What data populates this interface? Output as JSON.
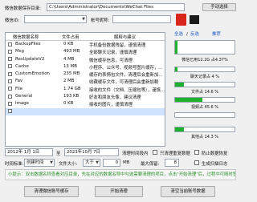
{
  "path_row": {
    "label": "微信数据保存目录:",
    "value": "C:\\Users\\Administrator\\Documents\\WeChat Files",
    "button": "手动选择"
  },
  "id_row": {
    "label": "微信ID:",
    "account_label": "帐号昵称:"
  },
  "table": {
    "headers": [
      "微信数据名称",
      "文件占用",
      "解释与建议"
    ],
    "rows": [
      {
        "name": "BackupFiles",
        "size": "0 KB",
        "desc": "手机备份数据残留，谨慎清理"
      },
      {
        "name": "Msg",
        "size": "493 MB",
        "desc": "全部聊天记录，谨慎清理"
      },
      {
        "name": "ResUpdateV2",
        "size": "4 MB",
        "desc": "微信缓存信息，可清理"
      },
      {
        "name": "Cache",
        "size": "13 MB",
        "desc": "小程序、公众号、视频号图片缓存，..."
      },
      {
        "name": "CustomEmotion",
        "size": "235 MB",
        "desc": "缓存的表情包文件，清理后会重新加..."
      },
      {
        "name": "Fav",
        "size": "2 MB",
        "desc": "收藏缓存文件，可清理后会重新加载"
      },
      {
        "name": "File",
        "size": "1.74 GB",
        "desc": "接收的文件（文档、压缩包等），谨慎..."
      },
      {
        "name": "General",
        "size": "193 KB",
        "desc": "好友和朋友头像，建议清理"
      },
      {
        "name": "Image",
        "size": "0 KB",
        "desc": "接收的图片，谨慎清理"
      },
      {
        "name": "",
        "size": "",
        "desc": ""
      }
    ]
  },
  "side": {
    "tab_all": "全选",
    "tab_sep": "/",
    "tab_invert": "反选",
    "tab_recommend": "推荐",
    "disk_label": "微信已用12.2G 占4.37%",
    "disk_pct": 0.0437,
    "bars": [
      {
        "label": "聊天记录占 4 %",
        "value": 0.04
      },
      {
        "label": "文件占 14.6 %",
        "value": 0.146
      },
      {
        "label": "视频占 45.6 %",
        "value": 0.456
      },
      {
        "label": "",
        "value": 0.0
      },
      {
        "label": "其他占 14.3 %",
        "value": 0.143
      }
    ]
  },
  "date_row": {
    "start": "2012年 1月 1日",
    "to": "至",
    "end": "2023年10月 7日",
    "only_clean_label": "清理时间段内",
    "only_dup_label": "只清理重复数据",
    "prevent_label": "防止数据恢复"
  },
  "size_row": {
    "time_label": "时间标准:",
    "time_value": "创建时间",
    "size_label": "文件大小:",
    "size_compare": "大于",
    "size_value": "0",
    "size_unit": "MB",
    "retain_label": "最大保留:",
    "retain_value": "8",
    "dup_label": "生成扫描日志"
  },
  "tip": "小提示：双击数据名称查看对应目录，先在对应的数据名称中勾选需要清理的项目，点击\"开始清理\"后，过程中可随时暂停、终止，清理前请先关闭微信以确保...",
  "buttons": {
    "clear_account": "清理微信账号缓存",
    "start": "开始清理",
    "clear_all": "清空当前账号数据"
  },
  "colors": {
    "bar_green": "#1eb12c",
    "tip_green": "#2d8f2d",
    "link_blue": "#1a55c7",
    "flag_red": "#d8261c"
  }
}
